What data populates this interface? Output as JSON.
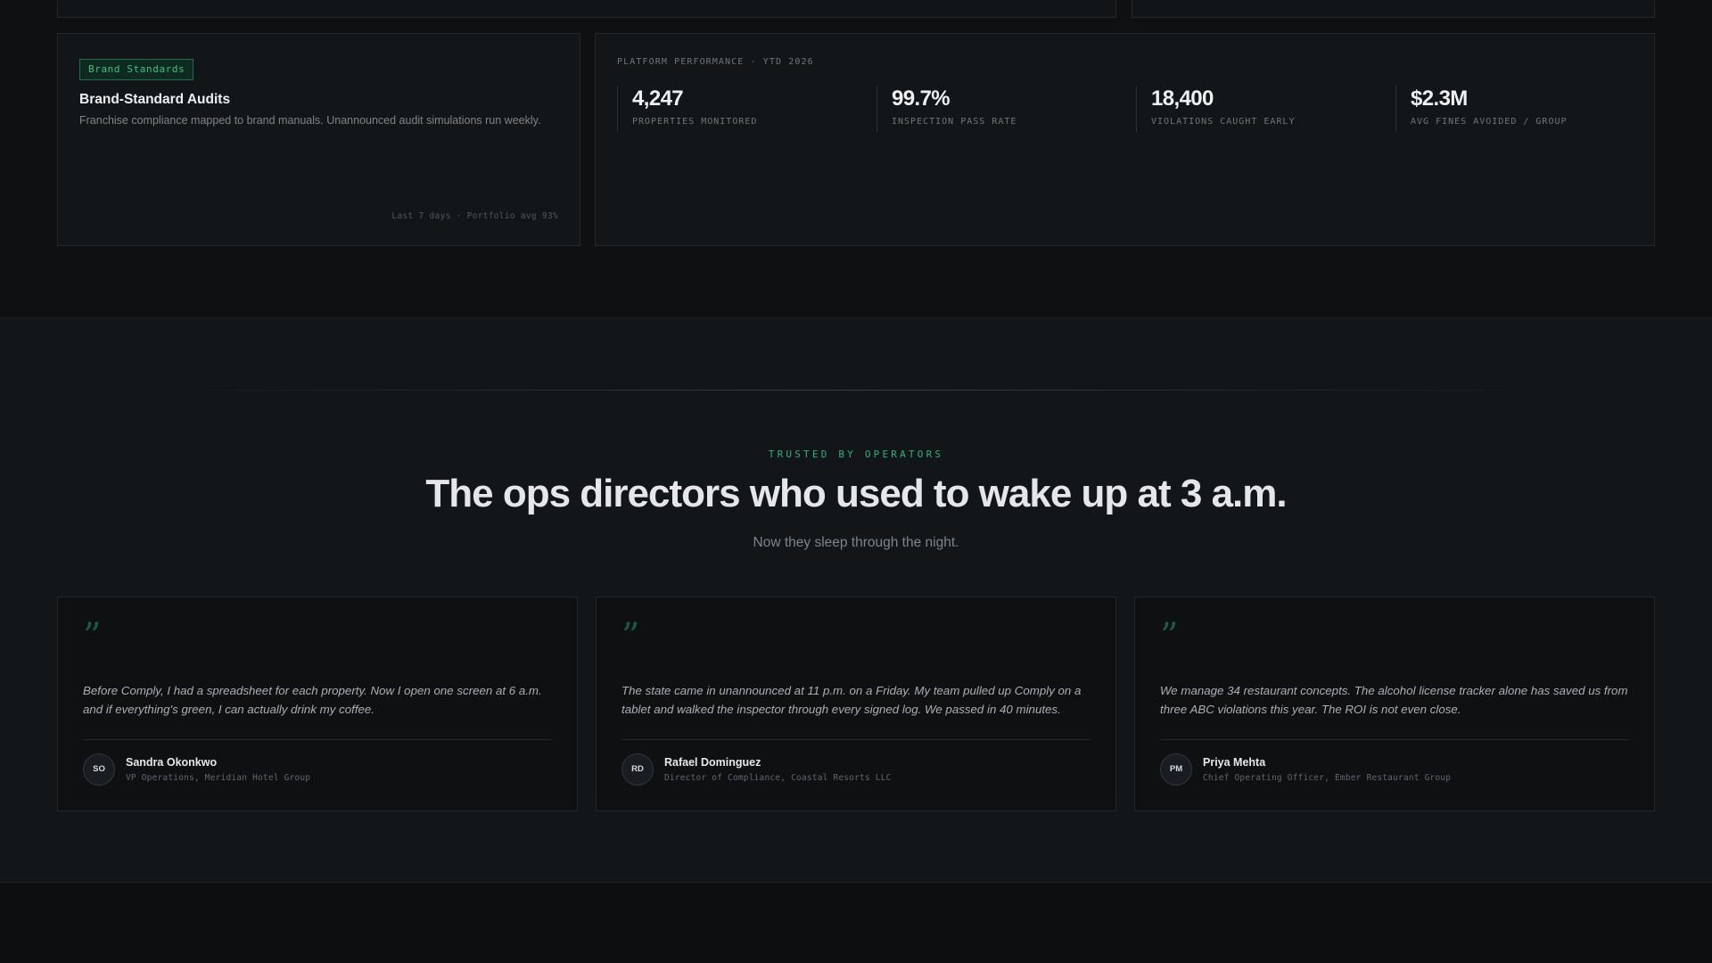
{
  "audits_card": {
    "tag": "Brand Standards",
    "title": "Brand-Standard Audits",
    "description": "Franchise compliance mapped to brand manuals. Unannounced audit simulations run weekly.",
    "footer": "Last 7 days · Portfolio avg 93%"
  },
  "performance": {
    "label": "PLATFORM PERFORMANCE · YTD 2026",
    "stats": [
      {
        "value": "4,247",
        "label": "PROPERTIES MONITORED"
      },
      {
        "value": "99.7%",
        "label": "INSPECTION PASS RATE"
      },
      {
        "value": "18,400",
        "label": "VIOLATIONS CAUGHT EARLY"
      },
      {
        "value": "$2.3M",
        "label": "AVG FINES AVOIDED / GROUP"
      }
    ]
  },
  "testimonials_section": {
    "eyebrow": "TRUSTED BY OPERATORS",
    "headline": "The ops directors who used to wake up at 3 a.m.",
    "subhead": "Now they sleep through the night.",
    "quote_mark": "”",
    "items": [
      {
        "quote": "Before Comply, I had a spreadsheet for each property. Now I open one screen at 6 a.m. and if everything's green, I can actually drink my coffee.",
        "initials": "SO",
        "name": "Sandra Okonkwo",
        "role": "VP Operations, Meridian Hotel Group"
      },
      {
        "quote": "The state came in unannounced at 11 p.m. on a Friday. My team pulled up Comply on a tablet and walked the inspector through every signed log. We passed in 40 minutes.",
        "initials": "RD",
        "name": "Rafael Dominguez",
        "role": "Director of Compliance, Coastal Resorts LLC"
      },
      {
        "quote": "We manage 34 restaurant concepts. The alcohol license tracker alone has saved us from three ABC violations this year. The ROI is not even close.",
        "initials": "PM",
        "name": "Priya Mehta",
        "role": "Chief Operating Officer, Ember Restaurant Group"
      }
    ]
  },
  "colors": {
    "accent": "#2fb07a",
    "background": "#0e1012",
    "card": "#131619"
  }
}
